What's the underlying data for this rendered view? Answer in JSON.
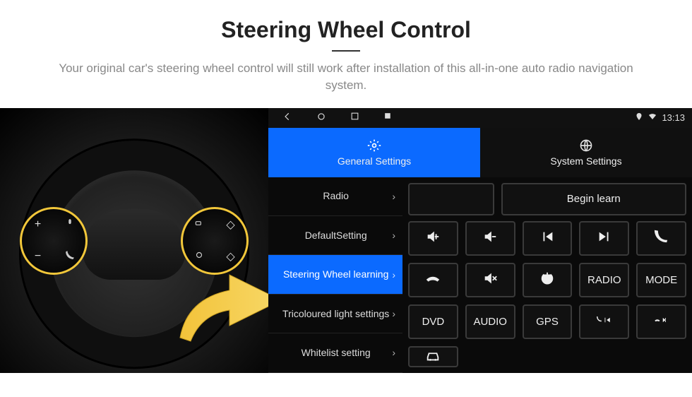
{
  "header": {
    "title": "Steering Wheel Control",
    "subtitle": "Your original car's steering wheel control will still work after installation of this all-in-one auto radio navigation system."
  },
  "statusbar": {
    "time": "13:13"
  },
  "tabs": [
    {
      "label": "General Settings",
      "icon": "gear-icon",
      "active": true
    },
    {
      "label": "System Settings",
      "icon": "globe-icon",
      "active": false
    }
  ],
  "sidebar": [
    {
      "label": "Radio",
      "active": false
    },
    {
      "label": "DefaultSetting",
      "active": false
    },
    {
      "label": "Steering Wheel learning",
      "active": true
    },
    {
      "label": "Tricoloured light settings",
      "active": false
    },
    {
      "label": "Whitelist setting",
      "active": false
    }
  ],
  "panel": {
    "begin_label": "Begin learn",
    "buttons": [
      {
        "name": "volume-up-button",
        "icon": "vol-up-icon",
        "text": ""
      },
      {
        "name": "volume-down-button",
        "icon": "vol-down-icon",
        "text": ""
      },
      {
        "name": "prev-track-button",
        "icon": "prev-icon",
        "text": ""
      },
      {
        "name": "next-track-button",
        "icon": "next-icon",
        "text": ""
      },
      {
        "name": "phone-button",
        "icon": "phone-icon",
        "text": ""
      },
      {
        "name": "hangup-button",
        "icon": "hangup-icon",
        "text": ""
      },
      {
        "name": "mute-button",
        "icon": "mute-icon",
        "text": ""
      },
      {
        "name": "power-button",
        "icon": "power-icon",
        "text": ""
      },
      {
        "name": "radio-button",
        "icon": "",
        "text": "RADIO"
      },
      {
        "name": "mode-button",
        "icon": "",
        "text": "MODE"
      },
      {
        "name": "dvd-button",
        "icon": "",
        "text": "DVD"
      },
      {
        "name": "audio-button",
        "icon": "",
        "text": "AUDIO"
      },
      {
        "name": "gps-button",
        "icon": "",
        "text": "GPS"
      },
      {
        "name": "phone-prev-button",
        "icon": "phone-prev-icon",
        "text": ""
      },
      {
        "name": "phone-next-button",
        "icon": "phone-next-icon",
        "text": ""
      },
      {
        "name": "car-button",
        "icon": "car-icon",
        "text": ""
      }
    ]
  },
  "wheel_controls": {
    "left": [
      "+",
      "voice",
      "−",
      "phone"
    ],
    "right": [
      "src-up",
      "nav-up",
      "src-cycle",
      "nav-down"
    ]
  }
}
